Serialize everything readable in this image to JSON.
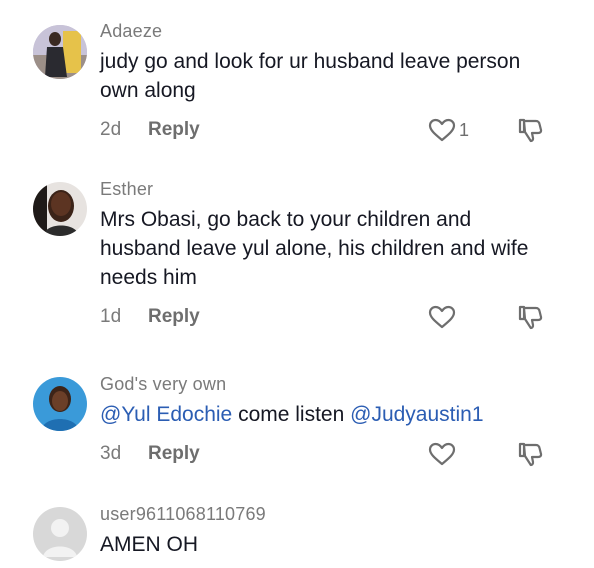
{
  "comments": [
    {
      "username": "Adaeze",
      "text": "judy go and look for ur husband leave person own along",
      "date": "2d",
      "reply_label": "Reply",
      "likes": "1",
      "avatar_icon": "user-photo-avatar"
    },
    {
      "username": "Esther",
      "text": "Mrs Obasi, go back to your children and husband leave yul alone, his children and wife needs him",
      "date": "1d",
      "reply_label": "Reply",
      "likes": "",
      "avatar_icon": "user-photo-avatar"
    },
    {
      "username": "God's very own",
      "mention_1": "@Yul Edochie",
      "text_middle": " come listen ",
      "mention_2": "@Judyaustin1",
      "date": "3d",
      "reply_label": "Reply",
      "likes": "",
      "avatar_icon": "user-photo-avatar"
    },
    {
      "username": "user9611068110769",
      "text": "AMEN OH",
      "avatar_icon": "default-user-avatar"
    }
  ],
  "colors": {
    "username": "#7a7a7a",
    "text": "#161823",
    "mention": "#2b5db3",
    "icon": "#6e6e6e"
  }
}
